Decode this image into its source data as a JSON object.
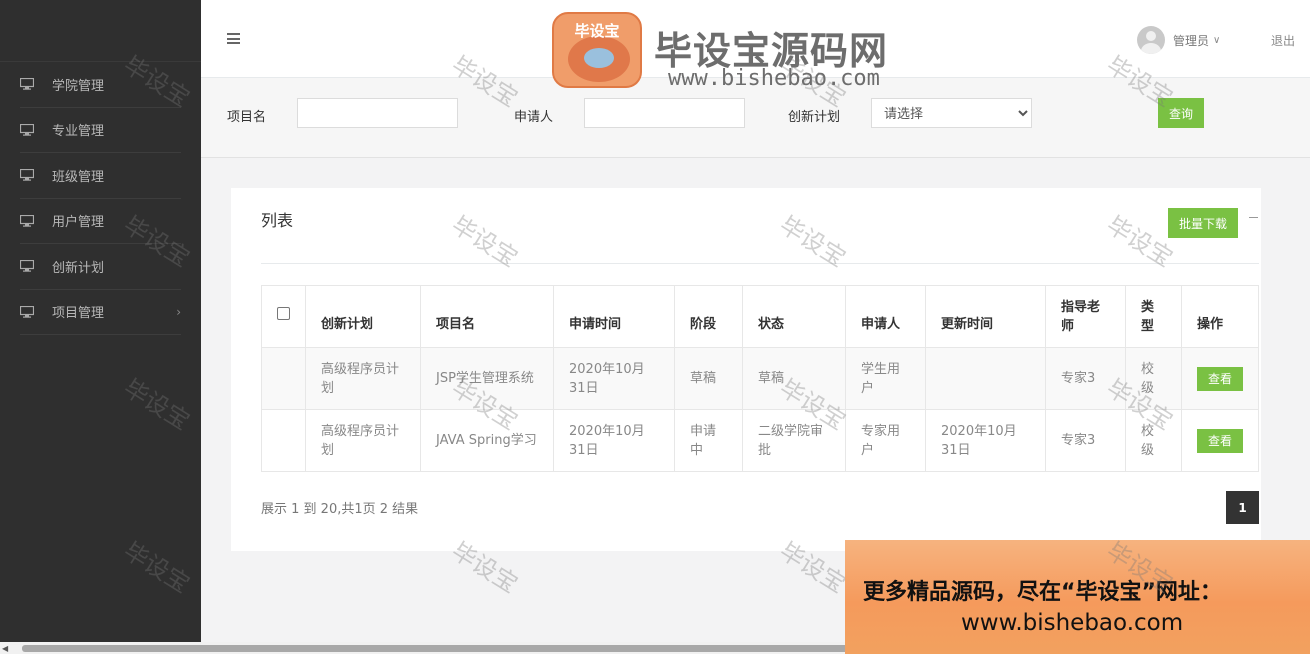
{
  "sidebar": {
    "items": [
      {
        "label": "学院管理",
        "icon": "monitor-icon"
      },
      {
        "label": "专业管理",
        "icon": "monitor-icon"
      },
      {
        "label": "班级管理",
        "icon": "monitor-icon"
      },
      {
        "label": "用户管理",
        "icon": "monitor-icon"
      },
      {
        "label": "创新计划",
        "icon": "monitor-icon"
      },
      {
        "label": "项目管理",
        "icon": "monitor-icon",
        "arrow": "›"
      }
    ]
  },
  "header": {
    "user_name": "管理员",
    "logout": "退出"
  },
  "search": {
    "project_label": "项目名",
    "applicant_label": "申请人",
    "plan_label": "创新计划",
    "plan_selected": "请选择",
    "query_button": "查询"
  },
  "panel": {
    "title": "列表",
    "batch_download": "批量下载"
  },
  "table": {
    "headers": [
      "创新计划",
      "项目名",
      "申请时间",
      "阶段",
      "状态",
      "申请人",
      "更新时间",
      "指导老师",
      "类型",
      "操作"
    ],
    "rows": [
      {
        "plan": "高级程序员计划",
        "project": "JSP学生管理系统",
        "apply_time": "2020年10月31日",
        "stage": "草稿",
        "status": "草稿",
        "applicant": "学生用户",
        "update_time": "",
        "advisor": "专家3",
        "type": "校级",
        "action": "查看"
      },
      {
        "plan": "高级程序员计划",
        "project": "JAVA Spring学习",
        "apply_time": "2020年10月31日",
        "stage": "申请中",
        "status": "二级学院审批",
        "applicant": "专家用户",
        "update_time": "2020年10月31日",
        "advisor": "专家3",
        "type": "校级",
        "action": "查看"
      }
    ]
  },
  "pagination": {
    "info": "展示 1 到 20,共1页 2 结果",
    "current_page": "1"
  },
  "watermark": {
    "brand_badge": "毕设宝",
    "brand_title": "毕设宝源码网",
    "brand_url": "www.bishebao.com",
    "tile_text": "毕设宝",
    "promo_line1": "更多精品源码，尽在“毕设宝”网址：",
    "promo_line2": "www.bishebao.com"
  },
  "colors": {
    "sidebar_bg": "#2f2f2f",
    "accent_green": "#7ac143",
    "page_btn": "#333333"
  }
}
